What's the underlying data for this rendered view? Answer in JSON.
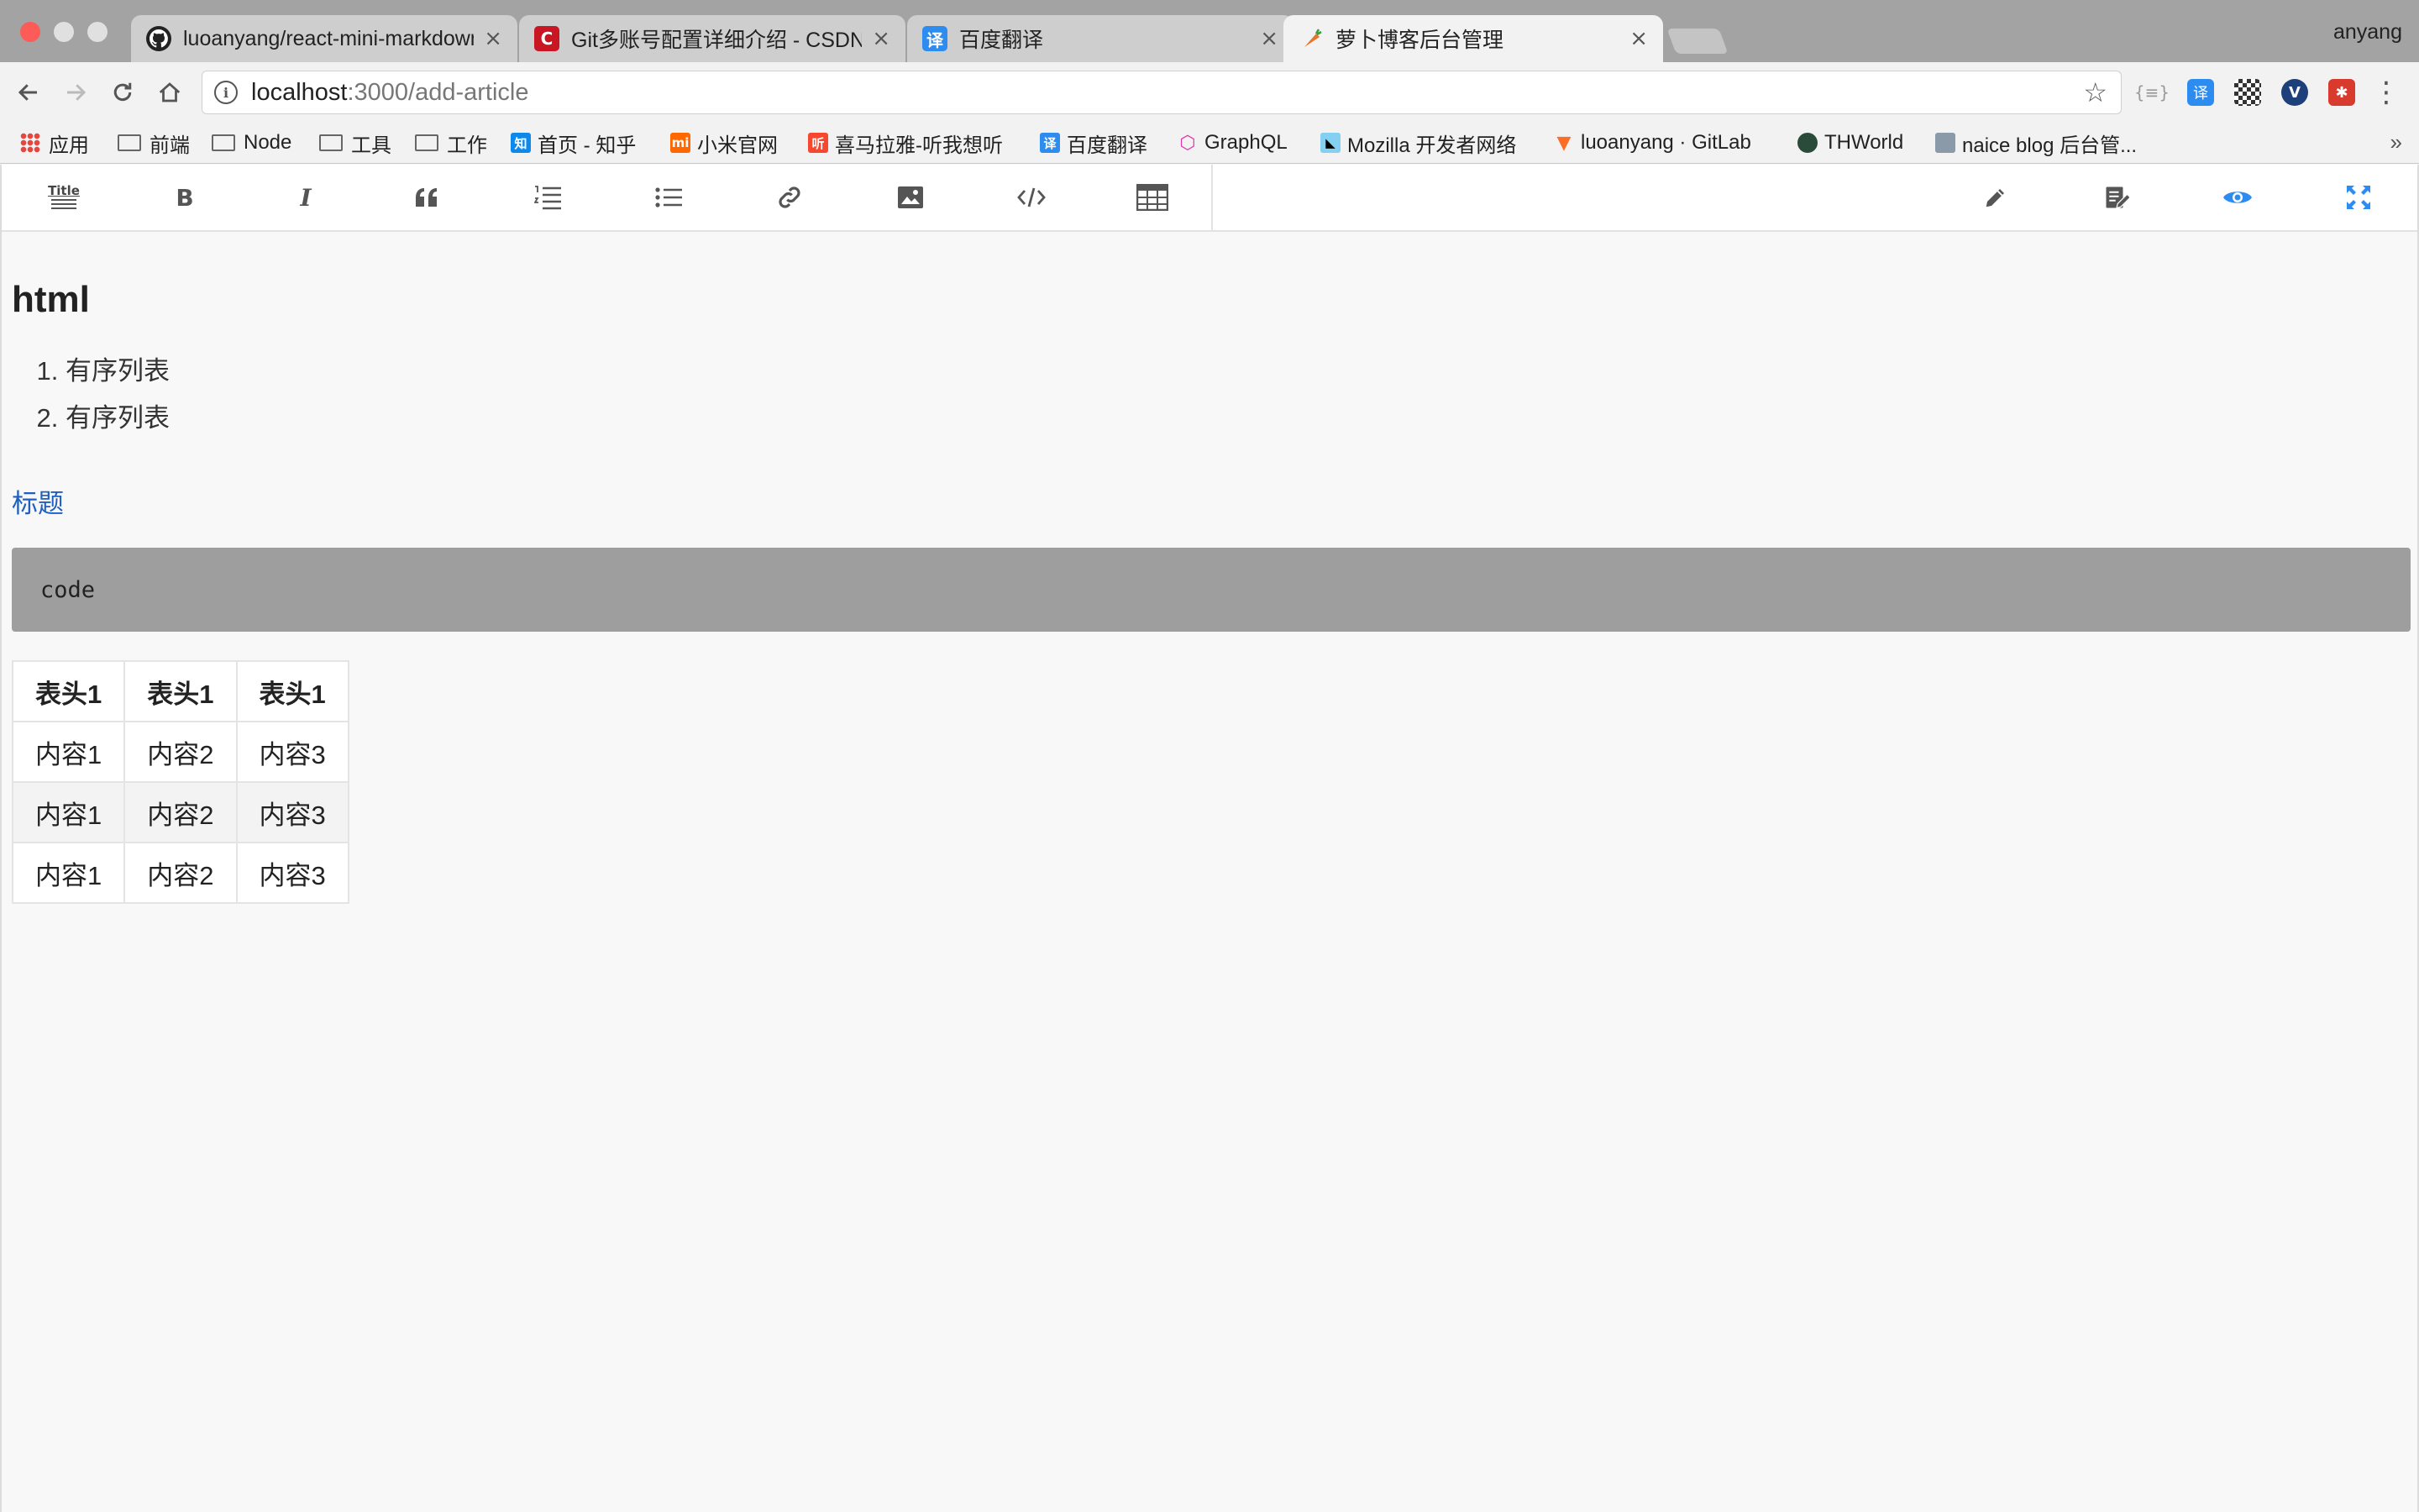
{
  "browser": {
    "tabs": [
      {
        "title": "luoanyang/react-mini-markdown",
        "icon": "github-icon",
        "color": "#222222"
      },
      {
        "title": "Git多账号配置详细介绍 - CSDN",
        "icon": "csdn-icon",
        "color": "#c81623"
      },
      {
        "title": "百度翻译",
        "icon": "baidu-translate-icon",
        "color": "#2d8cf0"
      },
      {
        "title": "萝卜博客后台管理",
        "icon": "carrot-icon",
        "color": "#e8742b",
        "active": true
      }
    ],
    "close_glyph": "×",
    "profile_name": "anyang",
    "url_host": "localhost",
    "url_path": ":3000/add-article",
    "bookmarks": {
      "apps": "应用",
      "folder1": "前端",
      "folder2": "Node",
      "folder3": "工具",
      "folder4": "工作",
      "zhihu": "首页 - 知乎",
      "xiaomi": "小米官网",
      "ximalaya": "喜马拉雅-听我想听",
      "baidu_fanyi": "百度翻译",
      "graphql": "GraphQL",
      "mdn": "Mozilla 开发者网络",
      "gitlab": "luoanyang · GitLab",
      "thworld": "THWorld",
      "naice": "naice blog 后台管..."
    },
    "bookmark_icon_glyphs": {
      "zhihu": "知",
      "xiaomi": "mi",
      "ximalaya": "听",
      "baidu": "译"
    }
  },
  "editor": {
    "toolbar": {
      "title_btn": "Title",
      "bold_btn": "B",
      "italic_btn": "I"
    },
    "preview": {
      "heading": "html",
      "ordered_list": [
        "有序列表",
        "有序列表"
      ],
      "link_text": "标题",
      "code": "code",
      "table": {
        "headers": [
          "表头1",
          "表头1",
          "表头1"
        ],
        "rows": [
          [
            "内容1",
            "内容2",
            "内容3"
          ],
          [
            "内容1",
            "内容2",
            "内容3"
          ],
          [
            "内容1",
            "内容2",
            "内容3"
          ]
        ]
      }
    },
    "accent_color": "#2d8cf0"
  }
}
